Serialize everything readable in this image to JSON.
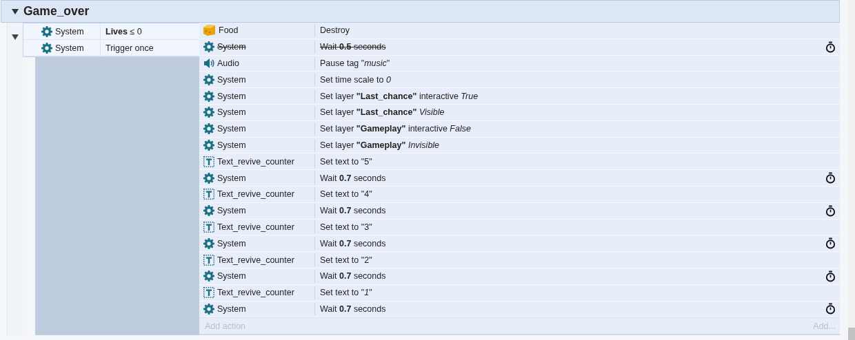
{
  "group": {
    "title": "Game_over",
    "expanded": true,
    "event": {
      "expanded": true,
      "conditions": [
        {
          "object": "System",
          "kind": "gear",
          "text": "**Lives** ≤ 0"
        },
        {
          "object": "System",
          "kind": "gear",
          "text": "Trigger once"
        }
      ],
      "actions": [
        {
          "object": "Food",
          "kind": "sprite",
          "text": "Destroy",
          "disabled": false,
          "async": false
        },
        {
          "object": "System",
          "kind": "gear",
          "text": "Wait **0.5** seconds",
          "disabled": true,
          "async": true
        },
        {
          "object": "Audio",
          "kind": "audio",
          "text": "Pause tag \"*music*\"",
          "disabled": false,
          "async": false
        },
        {
          "object": "System",
          "kind": "gear",
          "text": "Set time scale to *0*",
          "disabled": false,
          "async": false
        },
        {
          "object": "System",
          "kind": "gear",
          "text": "Set layer **\"Last_chance\"** interactive *True*",
          "disabled": false,
          "async": false
        },
        {
          "object": "System",
          "kind": "gear",
          "text": "Set layer **\"Last_chance\"** *Visible*",
          "disabled": false,
          "async": false
        },
        {
          "object": "System",
          "kind": "gear",
          "text": "Set layer **\"Gameplay\"** interactive *False*",
          "disabled": false,
          "async": false
        },
        {
          "object": "System",
          "kind": "gear",
          "text": "Set layer **\"Gameplay\"** *Invisible*",
          "disabled": false,
          "async": false
        },
        {
          "object": "Text_revive_counter",
          "kind": "text",
          "text": "Set text to \"5\"",
          "disabled": false,
          "async": false
        },
        {
          "object": "System",
          "kind": "gear",
          "text": "Wait **0.7** seconds",
          "disabled": false,
          "async": true
        },
        {
          "object": "Text_revive_counter",
          "kind": "text",
          "text": "Set text to \"4\"",
          "disabled": false,
          "async": false
        },
        {
          "object": "System",
          "kind": "gear",
          "text": "Wait **0.7** seconds",
          "disabled": false,
          "async": true
        },
        {
          "object": "Text_revive_counter",
          "kind": "text",
          "text": "Set text to \"3\"",
          "disabled": false,
          "async": false
        },
        {
          "object": "System",
          "kind": "gear",
          "text": "Wait **0.7** seconds",
          "disabled": false,
          "async": true
        },
        {
          "object": "Text_revive_counter",
          "kind": "text",
          "text": "Set text to \"2\"",
          "disabled": false,
          "async": false
        },
        {
          "object": "System",
          "kind": "gear",
          "text": "Wait **0.7** seconds",
          "disabled": false,
          "async": true
        },
        {
          "object": "Text_revive_counter",
          "kind": "text",
          "text": "Set text to \"*1*\"",
          "disabled": false,
          "async": false
        },
        {
          "object": "System",
          "kind": "gear",
          "text": "Wait **0.7** seconds",
          "disabled": false,
          "async": true
        }
      ],
      "add_action": {
        "label": "Add action",
        "shortcut": "Add..."
      }
    }
  }
}
